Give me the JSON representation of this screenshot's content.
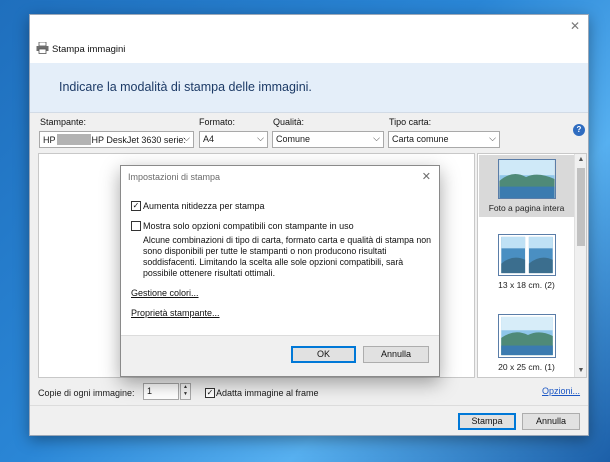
{
  "window": {
    "title": "Stampa immagini",
    "header": "Indicare la modalità di stampa delle immagini."
  },
  "fields": {
    "printer": {
      "label": "Stampante:",
      "prefix": "HP",
      "suffix": "HP DeskJet 3630 serie:"
    },
    "format": {
      "label": "Formato:",
      "value": "A4"
    },
    "quality": {
      "label": "Qualità:",
      "value": "Comune"
    },
    "paper": {
      "label": "Tipo carta:",
      "value": "Carta comune"
    }
  },
  "thumbnails": [
    {
      "label": "Foto a pagina intera",
      "selected": true
    },
    {
      "label": "13 x 18 cm. (2)",
      "selected": false
    },
    {
      "label": "20 x 25 cm. (1)",
      "selected": false
    }
  ],
  "bottom": {
    "copies_label": "Copie di ogni immagine:",
    "copies_value": "1",
    "fit_label": "Adatta immagine al frame",
    "fit_checked": true,
    "options_link": "Opzioni..."
  },
  "footer": {
    "print_button": "Stampa",
    "cancel_button": "Annulla"
  },
  "dialog": {
    "title": "Impostazioni di stampa",
    "sharpen_label": "Aumenta nitidezza per stampa",
    "sharpen_checked": true,
    "compatible_label": "Mostra solo opzioni compatibili con stampante in uso",
    "compatible_checked": false,
    "compatible_desc": "Alcune combinazioni di tipo di carta, formato carta e qualità di stampa non sono disponibili per tutte le stampanti o non producono risultati soddisfacenti. Limitando la scelta alle sole opzioni compatibili, sarà possibile ottenere risultati ottimali.",
    "color_link": "Gestione colori...",
    "printer_props_link": "Proprietà stampante...",
    "ok_button": "OK",
    "cancel_button": "Annulla"
  },
  "colors": {
    "accent": "#0078d7",
    "header_band": "#e4eef9",
    "link": "#1a56c4"
  },
  "icons": {
    "title": "printer-icon",
    "help": "help-icon",
    "close": "close-icon"
  }
}
